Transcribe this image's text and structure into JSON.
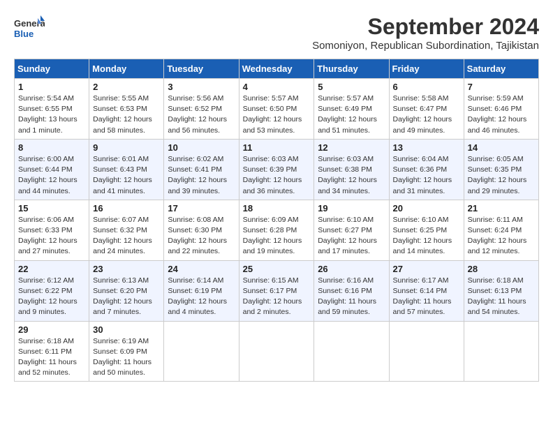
{
  "logo": {
    "line1": "General",
    "line2": "Blue"
  },
  "title": "September 2024",
  "subtitle": "Somoniyon, Republican Subordination, Tajikistan",
  "weekdays": [
    "Sunday",
    "Monday",
    "Tuesday",
    "Wednesday",
    "Thursday",
    "Friday",
    "Saturday"
  ],
  "weeks": [
    [
      {
        "day": "1",
        "info": "Sunrise: 5:54 AM\nSunset: 6:55 PM\nDaylight: 13 hours\nand 1 minute."
      },
      {
        "day": "2",
        "info": "Sunrise: 5:55 AM\nSunset: 6:53 PM\nDaylight: 12 hours\nand 58 minutes."
      },
      {
        "day": "3",
        "info": "Sunrise: 5:56 AM\nSunset: 6:52 PM\nDaylight: 12 hours\nand 56 minutes."
      },
      {
        "day": "4",
        "info": "Sunrise: 5:57 AM\nSunset: 6:50 PM\nDaylight: 12 hours\nand 53 minutes."
      },
      {
        "day": "5",
        "info": "Sunrise: 5:57 AM\nSunset: 6:49 PM\nDaylight: 12 hours\nand 51 minutes."
      },
      {
        "day": "6",
        "info": "Sunrise: 5:58 AM\nSunset: 6:47 PM\nDaylight: 12 hours\nand 49 minutes."
      },
      {
        "day": "7",
        "info": "Sunrise: 5:59 AM\nSunset: 6:46 PM\nDaylight: 12 hours\nand 46 minutes."
      }
    ],
    [
      {
        "day": "8",
        "info": "Sunrise: 6:00 AM\nSunset: 6:44 PM\nDaylight: 12 hours\nand 44 minutes."
      },
      {
        "day": "9",
        "info": "Sunrise: 6:01 AM\nSunset: 6:43 PM\nDaylight: 12 hours\nand 41 minutes."
      },
      {
        "day": "10",
        "info": "Sunrise: 6:02 AM\nSunset: 6:41 PM\nDaylight: 12 hours\nand 39 minutes."
      },
      {
        "day": "11",
        "info": "Sunrise: 6:03 AM\nSunset: 6:39 PM\nDaylight: 12 hours\nand 36 minutes."
      },
      {
        "day": "12",
        "info": "Sunrise: 6:03 AM\nSunset: 6:38 PM\nDaylight: 12 hours\nand 34 minutes."
      },
      {
        "day": "13",
        "info": "Sunrise: 6:04 AM\nSunset: 6:36 PM\nDaylight: 12 hours\nand 31 minutes."
      },
      {
        "day": "14",
        "info": "Sunrise: 6:05 AM\nSunset: 6:35 PM\nDaylight: 12 hours\nand 29 minutes."
      }
    ],
    [
      {
        "day": "15",
        "info": "Sunrise: 6:06 AM\nSunset: 6:33 PM\nDaylight: 12 hours\nand 27 minutes."
      },
      {
        "day": "16",
        "info": "Sunrise: 6:07 AM\nSunset: 6:32 PM\nDaylight: 12 hours\nand 24 minutes."
      },
      {
        "day": "17",
        "info": "Sunrise: 6:08 AM\nSunset: 6:30 PM\nDaylight: 12 hours\nand 22 minutes."
      },
      {
        "day": "18",
        "info": "Sunrise: 6:09 AM\nSunset: 6:28 PM\nDaylight: 12 hours\nand 19 minutes."
      },
      {
        "day": "19",
        "info": "Sunrise: 6:10 AM\nSunset: 6:27 PM\nDaylight: 12 hours\nand 17 minutes."
      },
      {
        "day": "20",
        "info": "Sunrise: 6:10 AM\nSunset: 6:25 PM\nDaylight: 12 hours\nand 14 minutes."
      },
      {
        "day": "21",
        "info": "Sunrise: 6:11 AM\nSunset: 6:24 PM\nDaylight: 12 hours\nand 12 minutes."
      }
    ],
    [
      {
        "day": "22",
        "info": "Sunrise: 6:12 AM\nSunset: 6:22 PM\nDaylight: 12 hours\nand 9 minutes."
      },
      {
        "day": "23",
        "info": "Sunrise: 6:13 AM\nSunset: 6:20 PM\nDaylight: 12 hours\nand 7 minutes."
      },
      {
        "day": "24",
        "info": "Sunrise: 6:14 AM\nSunset: 6:19 PM\nDaylight: 12 hours\nand 4 minutes."
      },
      {
        "day": "25",
        "info": "Sunrise: 6:15 AM\nSunset: 6:17 PM\nDaylight: 12 hours\nand 2 minutes."
      },
      {
        "day": "26",
        "info": "Sunrise: 6:16 AM\nSunset: 6:16 PM\nDaylight: 11 hours\nand 59 minutes."
      },
      {
        "day": "27",
        "info": "Sunrise: 6:17 AM\nSunset: 6:14 PM\nDaylight: 11 hours\nand 57 minutes."
      },
      {
        "day": "28",
        "info": "Sunrise: 6:18 AM\nSunset: 6:13 PM\nDaylight: 11 hours\nand 54 minutes."
      }
    ],
    [
      {
        "day": "29",
        "info": "Sunrise: 6:18 AM\nSunset: 6:11 PM\nDaylight: 11 hours\nand 52 minutes."
      },
      {
        "day": "30",
        "info": "Sunrise: 6:19 AM\nSunset: 6:09 PM\nDaylight: 11 hours\nand 50 minutes."
      },
      null,
      null,
      null,
      null,
      null
    ]
  ]
}
